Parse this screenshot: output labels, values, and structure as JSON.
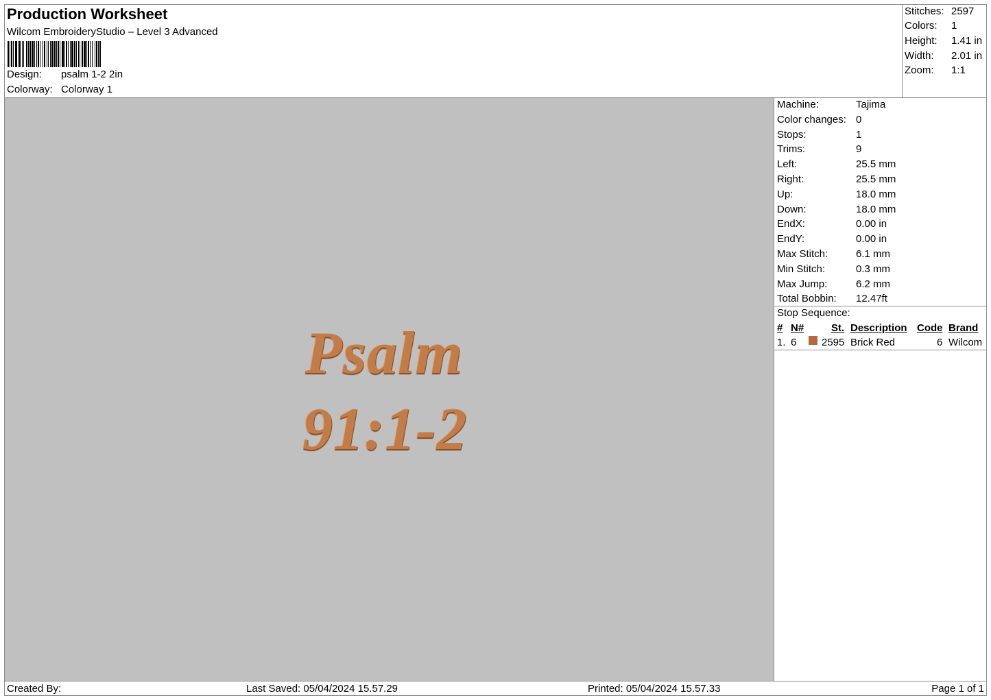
{
  "header": {
    "title": "Production Worksheet",
    "subtitle": "Wilcom EmbroideryStudio – Level 3 Advanced",
    "design_label": "Design:",
    "design_value": "psalm 1-2 2in",
    "colorway_label": "Colorway:",
    "colorway_value": "Colorway 1"
  },
  "summary": {
    "stitches_label": "Stitches:",
    "stitches_value": "2597",
    "colors_label": "Colors:",
    "colors_value": "1",
    "height_label": "Height:",
    "height_value": "1.41 in",
    "width_label": "Width:",
    "width_value": "2.01 in",
    "zoom_label": "Zoom:",
    "zoom_value": "1:1"
  },
  "design": {
    "line1": "Psalm",
    "line2": "91:1-2",
    "thread_color": "#c27c48",
    "background_color": "#c0c0c0"
  },
  "machine": {
    "rows": [
      {
        "label": "Machine:",
        "value": "Tajima"
      },
      {
        "label": "Color changes:",
        "value": "0"
      },
      {
        "label": "Stops:",
        "value": "1"
      },
      {
        "label": "Trims:",
        "value": "9"
      },
      {
        "label": "Left:",
        "value": "25.5 mm"
      },
      {
        "label": "Right:",
        "value": "25.5 mm"
      },
      {
        "label": "Up:",
        "value": "18.0 mm"
      },
      {
        "label": "Down:",
        "value": "18.0 mm"
      },
      {
        "label": "EndX:",
        "value": "0.00 in"
      },
      {
        "label": "EndY:",
        "value": "0.00 in"
      },
      {
        "label": "Max Stitch:",
        "value": "6.1 mm"
      },
      {
        "label": "Min Stitch:",
        "value": "0.3 mm"
      },
      {
        "label": "Max Jump:",
        "value": "6.2 mm"
      },
      {
        "label": "Total Bobbin:",
        "value": "12.47ft"
      }
    ]
  },
  "stop_sequence": {
    "title": "Stop Sequence:",
    "columns": {
      "num": "#",
      "needle": "N#",
      "stitches": "St.",
      "description": "Description",
      "code": "Code",
      "brand": "Brand"
    },
    "rows": [
      {
        "num": "1.",
        "needle": "6",
        "swatch": "#b5683f",
        "stitches": "2595",
        "description": "Brick Red",
        "code": "6",
        "brand": "Wilcom"
      }
    ]
  },
  "footer": {
    "created_by": "Created By:",
    "last_saved": "Last Saved: 05/04/2024 15.57.29",
    "printed": "Printed: 05/04/2024 15.57.33",
    "page": "Page 1 of 1"
  }
}
